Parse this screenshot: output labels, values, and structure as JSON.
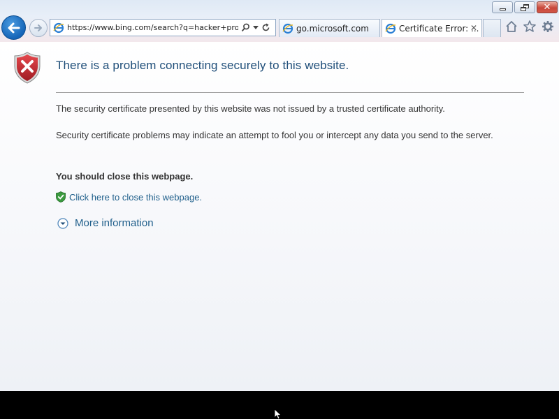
{
  "window": {
    "caption_buttons": [
      "minimize-icon",
      "restore-icon",
      "close-icon"
    ]
  },
  "toolbar": {
    "back_icon": "back-arrow-icon",
    "forward_icon": "forward-arrow-icon",
    "address_url": "https://www.bing.com/search?q=hacker+pro",
    "address_controls": [
      "search-icon",
      "dropdown-arrow-icon",
      "refresh-icon"
    ]
  },
  "tabs": [
    {
      "label": "go.microsoft.com",
      "icon": "ie-icon"
    },
    {
      "label": "Certificate Error: ...",
      "icon": "ie-icon",
      "close": "✕"
    }
  ],
  "command_icons": [
    "home-icon",
    "favorites-star-icon",
    "settings-gear-icon"
  ],
  "page": {
    "title": "There is a problem connecting securely to this website.",
    "paragraph1": "The security certificate presented by this website was not issued by a trusted certificate authority.",
    "paragraph2": "Security certificate problems may indicate an attempt to fool you or intercept any data you send to the server.",
    "recommendation": "You should close this webpage.",
    "close_link": "Click here to close this webpage.",
    "more_info": "More information"
  },
  "colors": {
    "title": "#1f4e79",
    "link": "#1f5f8b",
    "shield_red": "#c0262c"
  }
}
